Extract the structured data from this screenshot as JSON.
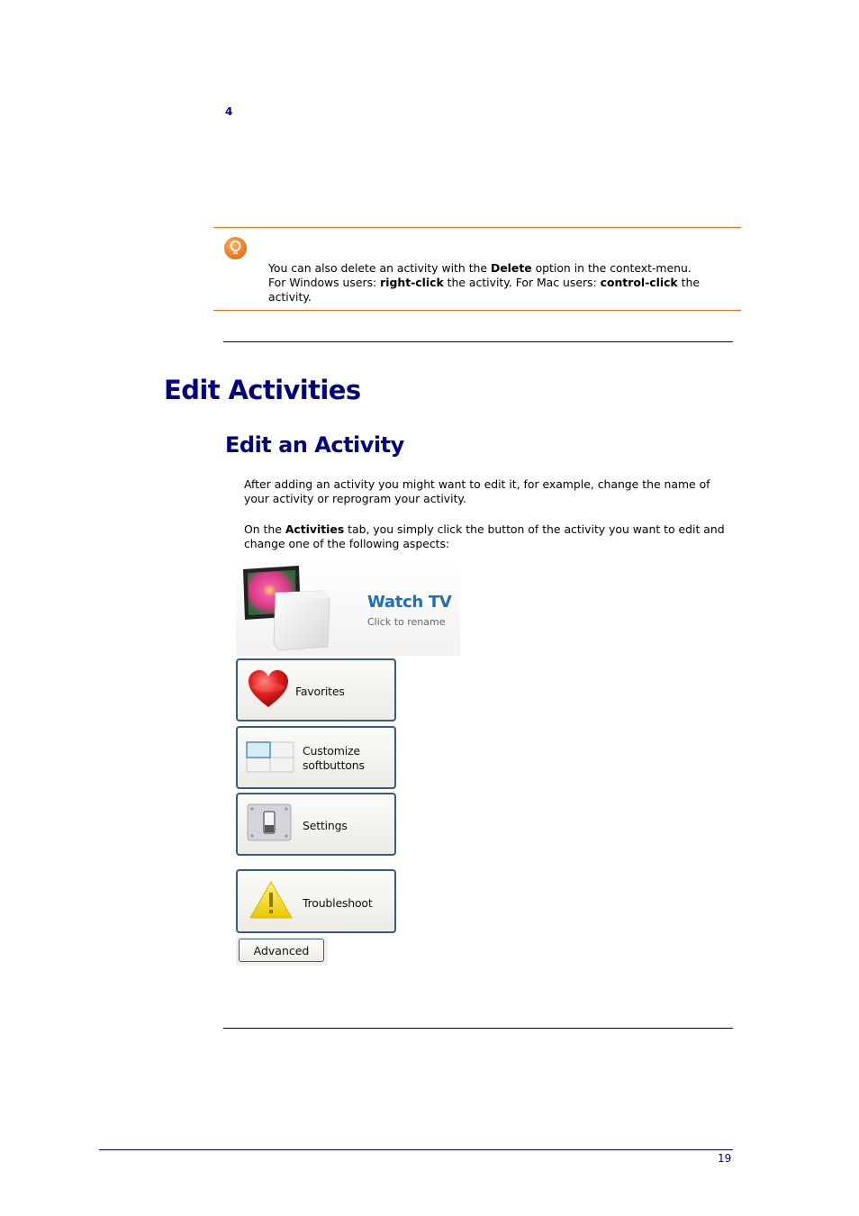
{
  "step_number": "4",
  "tip": {
    "icon": "lightbulb-icon",
    "line1_pre": "You can also delete an activity with the ",
    "line1_bold": "Delete",
    "line1_post": " option in the context-menu.",
    "line2_pre": "For Windows users: ",
    "line2_bold1": "right-click",
    "line2_mid": " the activity. For Mac users: ",
    "line2_bold2": "control-click",
    "line2_post": " the activity."
  },
  "section": {
    "title": "Edit Activities",
    "subtitle": "Edit an Activity",
    "para1": "After adding an activity you might want to edit it, for example, change the name of your activity or reprogram your activity.",
    "para2_pre": "On the ",
    "para2_bold": "Activities",
    "para2_post": " tab, you simply click the button of the activity you want to edit and change one of the following aspects:"
  },
  "activity_panel": {
    "title": "Watch TV",
    "subtitle": "Click to rename",
    "icon": "tv-icon"
  },
  "buttons": [
    {
      "label": "Favorites",
      "icon": "heart-icon"
    },
    {
      "label_line1": "Customize",
      "label_line2": "softbuttons",
      "icon": "grid-icon"
    },
    {
      "label": "Settings",
      "icon": "switch-icon"
    },
    {
      "label": "Troubleshoot",
      "icon": "warning-icon"
    }
  ],
  "advanced_button": "Advanced",
  "page_number": "19",
  "colors": {
    "heading": "#000080",
    "tip_rule": "#e8731e",
    "rule": "#000066",
    "watch_title": "#1e6fbf"
  }
}
